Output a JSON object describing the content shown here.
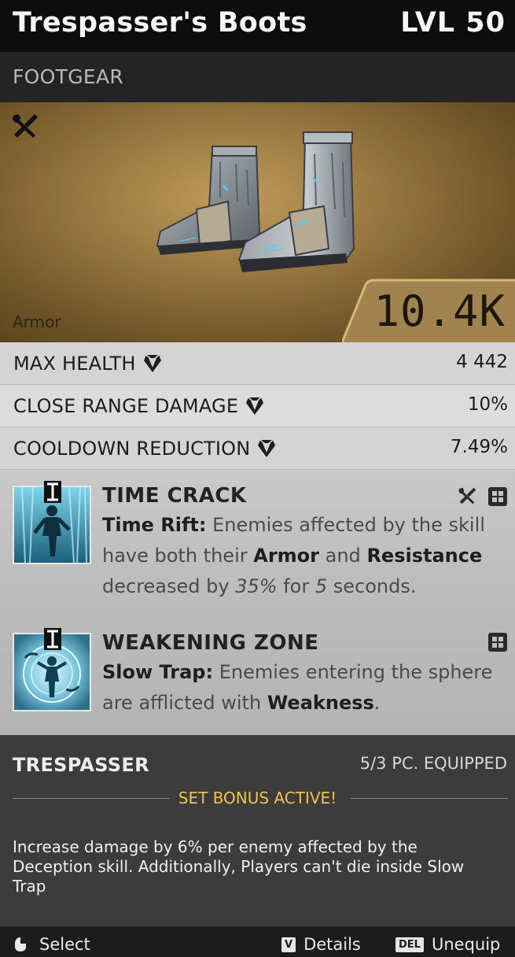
{
  "item": {
    "name": "Trespasser's Boots",
    "level": "LVL 50",
    "category": "FOOTGEAR",
    "armor_label": "Armor",
    "armor_value": "10.4K"
  },
  "stats": [
    {
      "label": "MAX HEALTH",
      "value": "4 442"
    },
    {
      "label": "CLOSE RANGE DAMAGE",
      "value": "10%"
    },
    {
      "label": "COOLDOWN REDUCTION",
      "value": "7.49%"
    }
  ],
  "skills": [
    {
      "name": "TIME CRACK",
      "mod_name": "Time Rift:",
      "desc_1": "Enemies affected by the skill have both their",
      "kw_1": "Armor",
      "desc_2": "and",
      "kw_2": "Resistance",
      "desc_3": "decreased by",
      "num_1": "35%",
      "desc_4": "for",
      "num_2": "5",
      "desc_5": "seconds.",
      "tags": [
        "wrench-icon",
        "grid-icon"
      ]
    },
    {
      "name": "WEAKENING ZONE",
      "mod_name": "Slow Trap:",
      "desc_1": "Enemies entering the sphere are afflicted with",
      "kw_1": "Weakness",
      "desc_2": ".",
      "tags": [
        "grid-icon"
      ]
    }
  ],
  "set": {
    "name": "TRESPASSER",
    "equipped": "5/3 PC. EQUIPPED",
    "status": "SET BONUS ACTIVE!",
    "bonus": "Increase damage by 6% per enemy affected by the Deception skill. Additionally, Players can't die inside Slow Trap"
  },
  "footer": {
    "select_label": "Select",
    "details_key": "V",
    "details_label": "Details",
    "unequip_key": "DEL",
    "unequip_label": "Unequip"
  },
  "colors": {
    "hero_bg": "#9a7a42",
    "set_bonus_text": "#f1c24b",
    "stat_row": "#d4d4d4"
  }
}
